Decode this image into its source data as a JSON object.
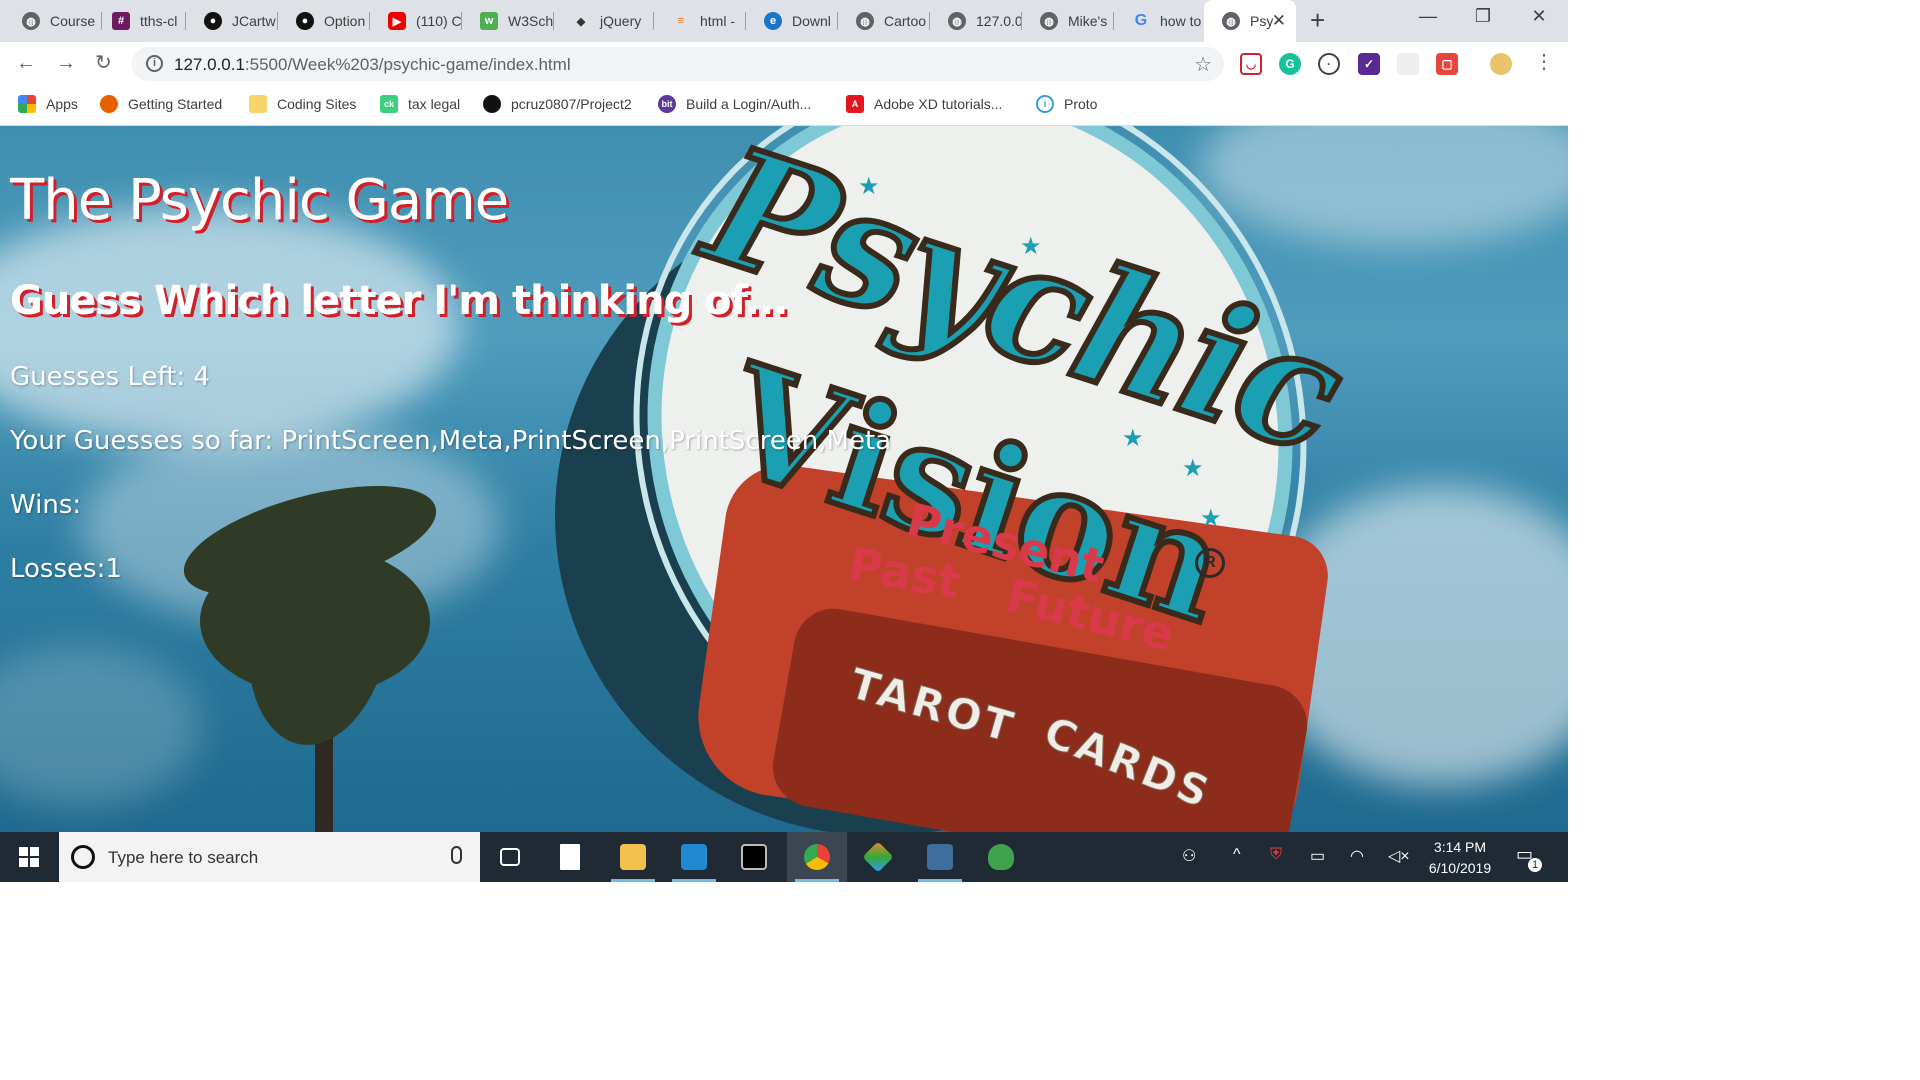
{
  "browser": {
    "tabs": [
      {
        "label": "Course",
        "favicon": "globe-icon"
      },
      {
        "label": "tths-cl",
        "favicon": "slack-icon"
      },
      {
        "label": "JCartw",
        "favicon": "github-icon"
      },
      {
        "label": "Option",
        "favicon": "github-icon"
      },
      {
        "label": "(110) C",
        "favicon": "youtube-icon"
      },
      {
        "label": "W3Sch",
        "favicon": "w3schools-icon"
      },
      {
        "label": "jQuery",
        "favicon": "codepen-icon"
      },
      {
        "label": "html -",
        "favicon": "stackoverflow-icon"
      },
      {
        "label": "Downl",
        "favicon": "edge-icon"
      },
      {
        "label": "Cartoo",
        "favicon": "globe-icon"
      },
      {
        "label": "127.0.0",
        "favicon": "globe-icon"
      },
      {
        "label": "Mike's",
        "favicon": "globe-icon"
      },
      {
        "label": "how to",
        "favicon": "google-icon"
      },
      {
        "label": "Psy",
        "favicon": "globe-icon",
        "active": true
      }
    ],
    "new_tab": "+",
    "window_controls": {
      "minimize": "—",
      "restore": "❐",
      "close": "✕"
    },
    "url_host": "127.0.0.1",
    "url_rest": ":5500/Week%203/psychic-game/index.html",
    "bookmarks": [
      {
        "label": "Apps",
        "icon": "apps-grid-icon"
      },
      {
        "label": "Getting Started",
        "icon": "firefox-icon"
      },
      {
        "label": "Coding Sites",
        "icon": "folder-icon"
      },
      {
        "label": "tax legal",
        "icon": "ck-icon"
      },
      {
        "label": "pcruz0807/Project2",
        "icon": "github-icon"
      },
      {
        "label": "Build a Login/Auth...",
        "icon": "bit-icon"
      },
      {
        "label": "Adobe XD tutorials...",
        "icon": "adobe-icon"
      },
      {
        "label": "Proto",
        "icon": "proto-icon"
      }
    ]
  },
  "game": {
    "title": "The Psychic Game",
    "subtitle": "Guess Which letter I'm thinking of...",
    "guesses_left_label": "Guesses Left: 4",
    "guesses_so_far_label": "Your Guesses so far: PrintScreen,Meta,PrintScreen,PrintScreen,Meta",
    "wins_label": "Wins:",
    "losses_label": "Losses:1"
  },
  "sign": {
    "line1": "Psychic",
    "line2": "Vision",
    "present": "Present",
    "past": "Past",
    "future": "Future",
    "registered": "R",
    "tarot": "TAROT",
    "cards": "CARDS"
  },
  "taskbar": {
    "search_placeholder": "Type here to search",
    "time": "3:14 PM",
    "date": "6/10/2019",
    "notification_count": "1"
  },
  "colors": {
    "title_shadow": "#d0202a",
    "sign_teal": "#1aa0b2",
    "sign_red": "#c2412a"
  }
}
